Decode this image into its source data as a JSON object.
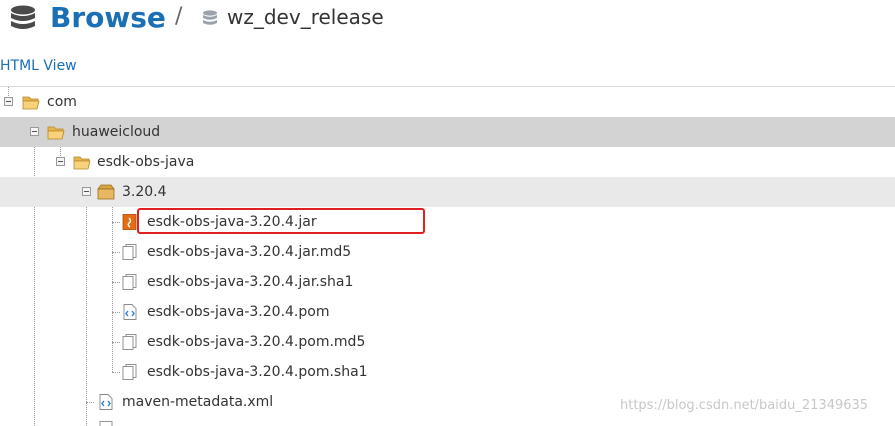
{
  "header": {
    "title": "Browse",
    "separator": "/",
    "repository": "wz_dev_release"
  },
  "html_view_link": "HTML View",
  "tree": [
    {
      "label": "com",
      "type": "folder-open",
      "state": "expanded"
    },
    {
      "label": "huaweicloud",
      "type": "folder-open",
      "state": "expanded",
      "selected": "dark"
    },
    {
      "label": "esdk-obs-java",
      "type": "folder-open",
      "state": "expanded"
    },
    {
      "label": "3.20.4",
      "type": "package",
      "state": "expanded",
      "selected": "light"
    },
    {
      "label": "esdk-obs-java-3.20.4.jar",
      "type": "jar-file",
      "highlighted": true
    },
    {
      "label": "esdk-obs-java-3.20.4.jar.md5",
      "type": "generic-file"
    },
    {
      "label": "esdk-obs-java-3.20.4.jar.sha1",
      "type": "generic-file"
    },
    {
      "label": "esdk-obs-java-3.20.4.pom",
      "type": "xml-file"
    },
    {
      "label": "esdk-obs-java-3.20.4.pom.md5",
      "type": "generic-file"
    },
    {
      "label": "esdk-obs-java-3.20.4.pom.sha1",
      "type": "generic-file"
    },
    {
      "label": "maven-metadata.xml",
      "type": "xml-file"
    }
  ],
  "watermark": "https://blog.csdn.net/baidu_21349635",
  "colors": {
    "accent": "#1a6fb5",
    "selected_dark": "#d3d3d3",
    "selected_light": "#e9e9e9",
    "highlight_border": "#e02020"
  }
}
